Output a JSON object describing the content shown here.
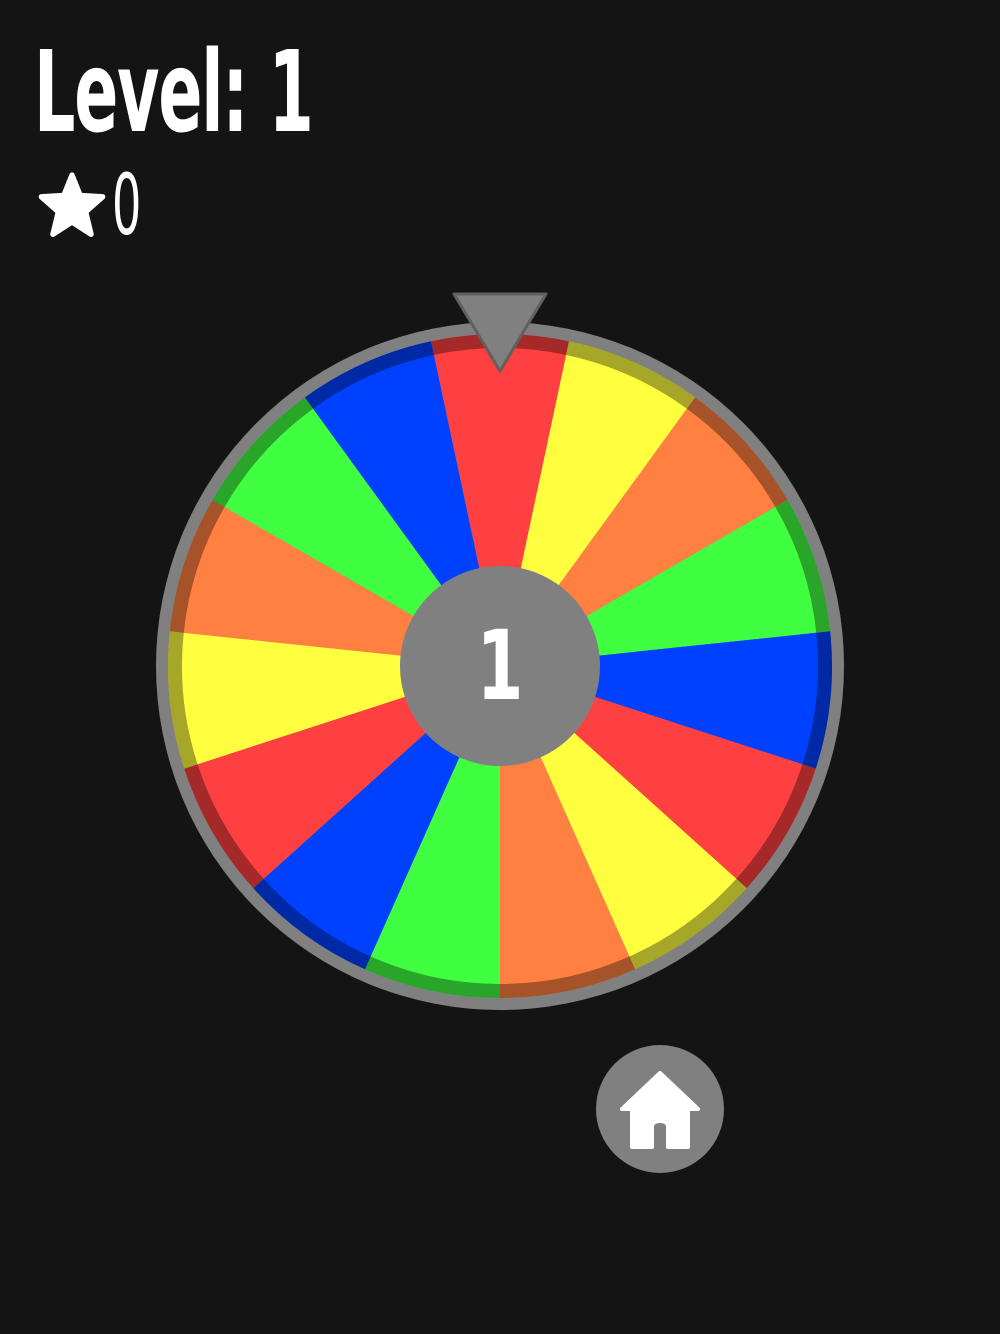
{
  "hud": {
    "level_text": "Level: 1",
    "score_value": "0",
    "score_icon": "star-icon"
  },
  "wheel": {
    "center_label": "1",
    "pointer_icon": "triangle-pointer-icon",
    "segments": [
      "red",
      "yellow",
      "orange",
      "green",
      "blue",
      "red",
      "yellow",
      "orange",
      "green",
      "blue",
      "red",
      "yellow",
      "orange",
      "green",
      "blue"
    ],
    "colors": {
      "red": "#ff4040",
      "yellow": "#ffff40",
      "orange": "#ff8040",
      "green": "#40ff40",
      "blue": "#0040ff",
      "rim": "#808080",
      "hub": "#808080",
      "background": "#141414"
    }
  },
  "home_button": {
    "icon": "home-icon"
  }
}
